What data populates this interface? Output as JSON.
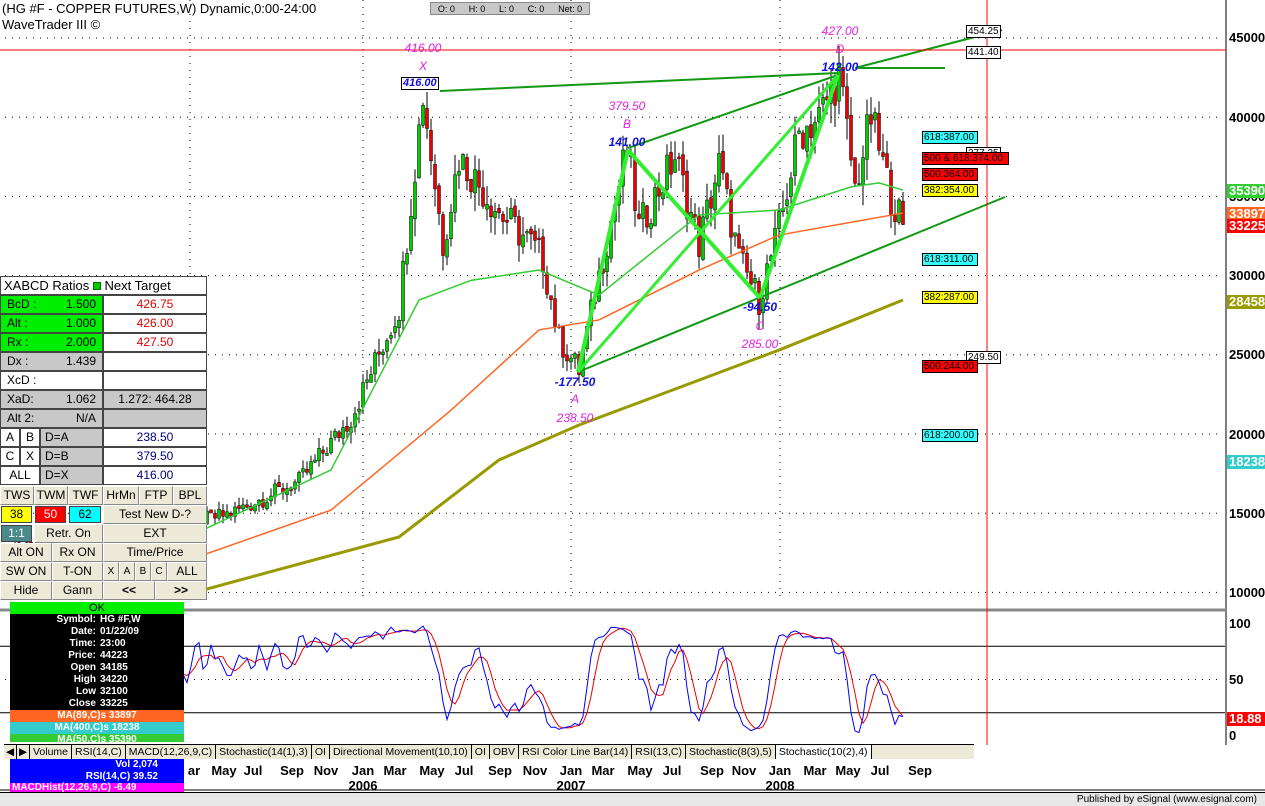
{
  "header": {
    "title": "(HG #F - COPPER FUTURES,W) Dynamic,0:00-24:00",
    "subtitle": "WaveTrader III ©",
    "ohlc": [
      "O: 0",
      "H: 0",
      "L: 0",
      "C: 0",
      "Net: 0"
    ]
  },
  "price_axis": {
    "ticks": [
      "45000",
      "40000",
      "35000",
      "30000",
      "25000",
      "20000",
      "15000",
      "10000"
    ],
    "tags": {
      "ma50": "35390",
      "ma89": "33897",
      "close": "33225",
      "ma400_a": "28458",
      "ma400_b": "18238"
    }
  },
  "stoch_axis": {
    "ticks": [
      "100",
      "50",
      "0"
    ],
    "value": "18.88"
  },
  "pattern": {
    "x_price": "416.00",
    "x_label": "X",
    "x_ratio": "416.00",
    "b_price": "379.50",
    "b_label": "B",
    "b_ratio": "141.00",
    "d_price": "427.00",
    "d_label": "D",
    "d_ratio": "142.00",
    "a_ratio": "-177.50",
    "a_label": "A",
    "a_price": "238.50",
    "c_ratio": "-94.50",
    "c_label": "C",
    "c_price": "285.00"
  },
  "levels": {
    "l454": "454.25",
    "l441": "441.40",
    "l377": "377.25",
    "l249": "249.50",
    "f1": "618:387.00",
    "f2": "500 & 618:374.00",
    "f3": "500:364.00",
    "f4": "382:354.00",
    "f5": "618:311.00",
    "f6": "382:287.00",
    "f7": "500:244.00",
    "f8": "618:200.00"
  },
  "panel": {
    "header": "XABCD Ratios",
    "header2": "Next Target",
    "rows": [
      {
        "k": "BcD :",
        "v": "1.500",
        "t": "426.75"
      },
      {
        "k": "Alt  :",
        "v": "1.000",
        "t": "426.00"
      },
      {
        "k": "Rx  :",
        "v": "2.000",
        "t": "427.50"
      },
      {
        "k": "Dx  :",
        "v": "1.439",
        "t": ""
      },
      {
        "k": "XcD :",
        "v": "",
        "t": ""
      },
      {
        "k": "XaD:",
        "v": "1.062",
        "t": "1.272: 464.28"
      },
      {
        "k": "Alt 2:",
        "v": "N/A",
        "t": ""
      }
    ],
    "targets": [
      {
        "a": "A",
        "b": "B",
        "d": "D=A",
        "v": "238.50"
      },
      {
        "a": "C",
        "b": "X",
        "d": "D=B",
        "v": "379.50"
      },
      {
        "a": "ALL",
        "d": "D=X",
        "v": "416.00"
      }
    ],
    "buttons": {
      "tws": "TWS",
      "twm": "TWM",
      "twf": "TWF",
      "hrmn": "HrMn",
      "ftp": "FTP",
      "bpl": "BPL",
      "b38": "38",
      "b50": "50",
      "b62": "62",
      "test": "Test New D-?",
      "r11": "1:1",
      "retr": "Retr. On",
      "ext": "EXT",
      "alton": "Alt ON",
      "rxon": "Rx ON",
      "tp": "Time/Price",
      "swon": "SW ON",
      "ton": "T-ON",
      "x": "X",
      "a": "A",
      "b": "B",
      "c": "C",
      "all": "ALL",
      "hide": "Hide",
      "gann": "Gann",
      "prev": "<<",
      "next": ">>"
    }
  },
  "info": {
    "ok": "OK",
    "rows": [
      {
        "k": "Symbol:",
        "v": "HG #F,W"
      },
      {
        "k": "Date:",
        "v": "01/22/09"
      },
      {
        "k": "Time:",
        "v": "23:00"
      },
      {
        "k": "Price:",
        "v": "44223"
      },
      {
        "k": "Open",
        "v": "34185"
      },
      {
        "k": "High",
        "v": "34220"
      },
      {
        "k": "Low",
        "v": "32100"
      },
      {
        "k": "Close",
        "v": "33225"
      }
    ],
    "ma89": "MA(89,C)s 33897",
    "ma400": "MA(400,C)s 18238",
    "ma50": "MA(50,C)s 35390",
    "vol": "Vol 2,074",
    "rsi": "RSI(14,C) 39.52",
    "macd": "MACDHist(12,26,9,C) -6.49"
  },
  "tabs": [
    "Volume",
    "RSI(14,C)",
    "MACD(12,26,9,C)",
    "Stochastic(14(1),3)",
    "OI",
    "Directional Movement(10,10)",
    "OI",
    "OBV",
    "RSI Color Line Bar(14)",
    "RSI(13,C)",
    "Stochastic(8(3),5)",
    "Stochastic(10(2),4)"
  ],
  "months": [
    "ar",
    "May",
    "Jul",
    "Sep",
    "Nov",
    "Jan",
    "Mar",
    "May",
    "Jul",
    "Sep",
    "Nov",
    "Jan",
    "Mar",
    "May",
    "Jul",
    "Sep",
    "Nov",
    "Jan",
    "Mar",
    "May",
    "Jul",
    "Sep"
  ],
  "years": [
    "2006",
    "2007",
    "2008"
  ],
  "footer": "Published by eSignal (www.esignal.com)",
  "colors": {
    "ma50": "#33cc33",
    "ma89": "#ff6622",
    "ma400": "#999900",
    "pattern": "#33ee33",
    "trend": "#119911",
    "cursor": "#ff0000"
  },
  "chart_data": {
    "type": "candlestick",
    "title": "HG #F - COPPER FUTURES, Weekly",
    "ylim": [
      9000,
      47000
    ],
    "x_unit": "week index from Jan 2005",
    "closes": [
      [
        -36,
        12800
      ],
      [
        -16,
        13500
      ],
      [
        11,
        14500
      ],
      [
        19,
        15000
      ],
      [
        36,
        17000
      ],
      [
        49,
        21000
      ],
      [
        61,
        28000
      ],
      [
        65,
        37000
      ],
      [
        67,
        41500
      ],
      [
        72,
        32000
      ],
      [
        76,
        37500
      ],
      [
        86,
        34000
      ],
      [
        94,
        32000
      ],
      [
        97,
        31000
      ],
      [
        101,
        26000
      ],
      [
        106,
        24000
      ],
      [
        111,
        30000
      ],
      [
        118,
        38000
      ],
      [
        121,
        33000
      ],
      [
        130,
        37500
      ],
      [
        136,
        32000
      ],
      [
        141,
        37000
      ],
      [
        146,
        31000
      ],
      [
        151,
        28500
      ],
      [
        156,
        33000
      ],
      [
        161,
        39000
      ],
      [
        166,
        40000
      ],
      [
        171,
        42700
      ],
      [
        175,
        35500
      ],
      [
        179,
        40000
      ],
      [
        184,
        35000
      ],
      [
        187,
        33225
      ]
    ],
    "ma50": [
      [
        12,
        13940
      ],
      [
        44,
        17730
      ],
      [
        66,
        28460
      ],
      [
        79,
        29700
      ],
      [
        96,
        30350
      ],
      [
        111,
        28770
      ],
      [
        136,
        33830
      ],
      [
        156,
        34140
      ],
      [
        174,
        35600
      ],
      [
        181,
        35850
      ],
      [
        187,
        35400
      ]
    ],
    "ma89": [
      [
        12,
        12360
      ],
      [
        44,
        15200
      ],
      [
        74,
        21500
      ],
      [
        96,
        26570
      ],
      [
        111,
        27200
      ],
      [
        136,
        30350
      ],
      [
        156,
        32560
      ],
      [
        187,
        33950
      ]
    ],
    "ma400": [
      [
        12,
        10150
      ],
      [
        61,
        13500
      ],
      [
        86,
        18360
      ],
      [
        106,
        20570
      ],
      [
        136,
        23400
      ],
      [
        156,
        25300
      ],
      [
        187,
        28460
      ]
    ],
    "stochastic": {
      "period": 10,
      "smooth": 2,
      "signal": 4,
      "ylim": [
        0,
        100
      ],
      "levels": [
        20,
        50,
        80
      ]
    }
  }
}
